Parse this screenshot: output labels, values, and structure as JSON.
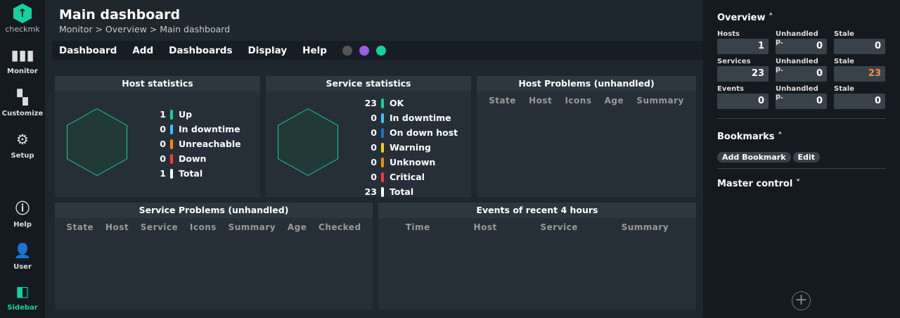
{
  "nav": {
    "logo": "checkmk",
    "items": [
      {
        "label": "Monitor",
        "icon": "bar-chart-icon"
      },
      {
        "label": "Customize",
        "icon": "grid-icon"
      },
      {
        "label": "Setup",
        "icon": "gear-icon"
      },
      {
        "label": "Help",
        "icon": "info-icon"
      },
      {
        "label": "User",
        "icon": "user-icon"
      },
      {
        "label": "Sidebar",
        "icon": "sidebar-icon"
      }
    ]
  },
  "header": {
    "title": "Main dashboard",
    "breadcrumb": "Monitor > Overview > Main dashboard"
  },
  "menu": [
    "Dashboard",
    "Add",
    "Dashboards",
    "Display",
    "Help"
  ],
  "host_stats": {
    "title": "Host statistics",
    "rows": [
      {
        "n": "1",
        "label": "Up",
        "color": "#15d1a0"
      },
      {
        "n": "0",
        "label": "In downtime",
        "color": "#3cc2ff"
      },
      {
        "n": "0",
        "label": "Unreachable",
        "color": "#ff8a00"
      },
      {
        "n": "0",
        "label": "Down",
        "color": "#ff3838"
      },
      {
        "n": "1",
        "label": "Total",
        "color": "#ffffff"
      }
    ]
  },
  "service_stats": {
    "title": "Service statistics",
    "rows": [
      {
        "n": "23",
        "label": "OK",
        "color": "#15d1a0"
      },
      {
        "n": "0",
        "label": "In downtime",
        "color": "#3cc2ff"
      },
      {
        "n": "0",
        "label": "On down host",
        "color": "#1e6fd0"
      },
      {
        "n": "0",
        "label": "Warning",
        "color": "#ffd000"
      },
      {
        "n": "0",
        "label": "Unknown",
        "color": "#ff8a00"
      },
      {
        "n": "0",
        "label": "Critical",
        "color": "#ff3838"
      },
      {
        "n": "23",
        "label": "Total",
        "color": "#ffffff"
      }
    ]
  },
  "host_problems": {
    "title": "Host Problems (unhandled)",
    "cols": [
      "State",
      "Host",
      "Icons",
      "Age",
      "Summary"
    ]
  },
  "service_problems": {
    "title": "Service Problems (unhandled)",
    "cols": [
      "State",
      "Host",
      "Service",
      "Icons",
      "Summary",
      "Age",
      "Checked"
    ]
  },
  "events": {
    "title": "Events of recent 4 hours",
    "cols": [
      "Time",
      "Host",
      "Service",
      "Summary"
    ]
  },
  "sidebar": {
    "overview": "Overview",
    "cells": [
      {
        "l": "Hosts",
        "v": "1"
      },
      {
        "l": "Unhandled p.",
        "v": "0"
      },
      {
        "l": "Stale",
        "v": "0"
      },
      {
        "l": "Services",
        "v": "23"
      },
      {
        "l": "Unhandled p.",
        "v": "0"
      },
      {
        "l": "Stale",
        "v": "23",
        "color": "#ff8a4a"
      },
      {
        "l": "Events",
        "v": "0"
      },
      {
        "l": "Unhandled p.",
        "v": "0"
      },
      {
        "l": "Stale",
        "v": "0"
      }
    ],
    "bookmarks": "Bookmarks",
    "add_bookmark": "Add Bookmark",
    "edit": "Edit",
    "master_control": "Master control"
  }
}
